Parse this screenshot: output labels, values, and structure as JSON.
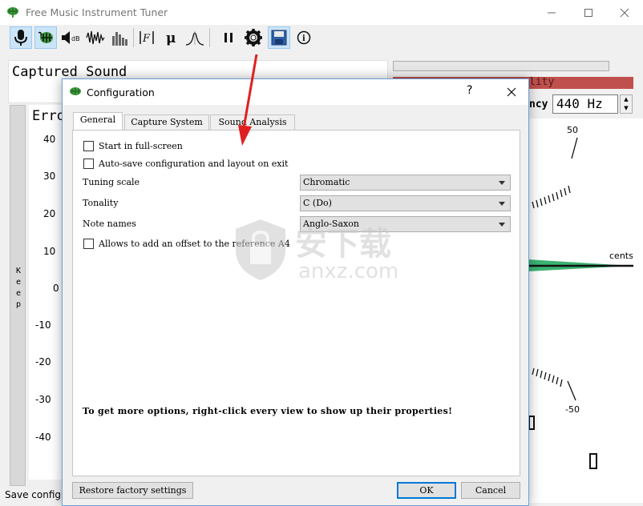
{
  "window": {
    "title": "Free Music Instrument Tuner"
  },
  "main": {
    "captured_sound_label": "Captured Sound",
    "error_label": "Erro",
    "keep_label": "Keep",
    "error_ticks": [
      "40",
      "30",
      "20",
      "10",
      "0",
      "-10",
      "-20",
      "-30",
      "-40"
    ],
    "status_text": "Save config",
    "quality_text": "lity",
    "frequency_label": "ncy",
    "frequency_value": "440 Hz",
    "meter_top_label": "50",
    "meter_bottom_label": "-50",
    "meter_unit_label": "cents",
    "meter_bottom_digit": "0"
  },
  "toolbar": {
    "icons": [
      "microphone-icon",
      "lizard-icon",
      "volume-icon",
      "waveform-icon",
      "spectrum-icon",
      "formant-icon",
      "mu-icon",
      "gaussian-icon",
      "pause-icon",
      "gear-icon",
      "save-icon",
      "info-icon"
    ]
  },
  "dialog": {
    "title": "Configuration",
    "help_label": "?",
    "tabs": [
      {
        "label": "General"
      },
      {
        "label": "Capture System"
      },
      {
        "label": "Sound Analysis"
      }
    ],
    "general": {
      "start_fullscreen_label": "Start in full-screen",
      "autosave_label": "Auto-save configuration and layout on exit",
      "tuning_scale_label": "Tuning scale",
      "tuning_scale_value": "Chromatic",
      "tonality_label": "Tonality",
      "tonality_value": "C (Do)",
      "note_names_label": "Note names",
      "note_names_value": "Anglo-Saxon",
      "offset_label": "Allows to add an offset to the reference A4",
      "hint_text": "To get more options, right-click every view to show up their properties!"
    },
    "buttons": {
      "restore_label": "Restore factory settings",
      "ok_label": "OK",
      "cancel_label": "Cancel"
    }
  },
  "watermark": {
    "text": "安下载",
    "subtext": "anxz.com"
  },
  "colors": {
    "quality_red": "#c0504d",
    "accent_blue": "#0078d7",
    "arrow_red": "#e02020",
    "meter_green": "#3cb371"
  }
}
